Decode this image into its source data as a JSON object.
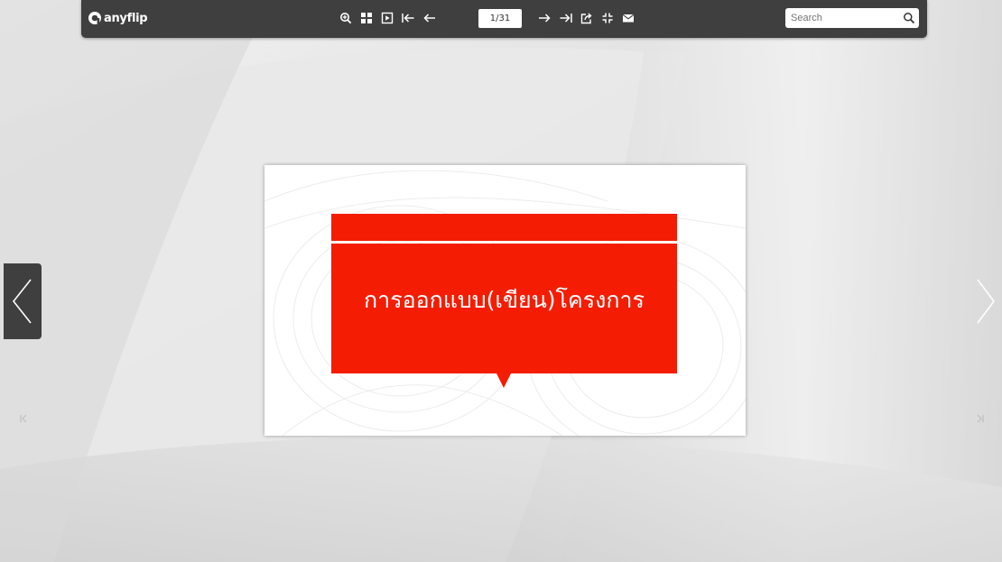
{
  "app": {
    "logo_text": "anyflip"
  },
  "toolbar": {
    "zoom_in": "zoom-in-icon",
    "thumbnails": "thumbnails-icon",
    "autoplay": "autoplay-icon",
    "first_page": "first-page-icon",
    "previous_page": "previous-page-icon",
    "page_indicator": "1/31",
    "next_page": "next-page-icon",
    "last_page": "last-page-icon",
    "share": "share-icon",
    "fullscreen": "fullscreen-icon",
    "email": "email-icon"
  },
  "search": {
    "placeholder": "Search"
  },
  "page": {
    "title": "การออกแบบ(เขียน)โครงการ"
  },
  "colors": {
    "toolbar_bg": "#3f3f3f",
    "accent_red": "#f41d04",
    "background": "#e6e6e6"
  }
}
